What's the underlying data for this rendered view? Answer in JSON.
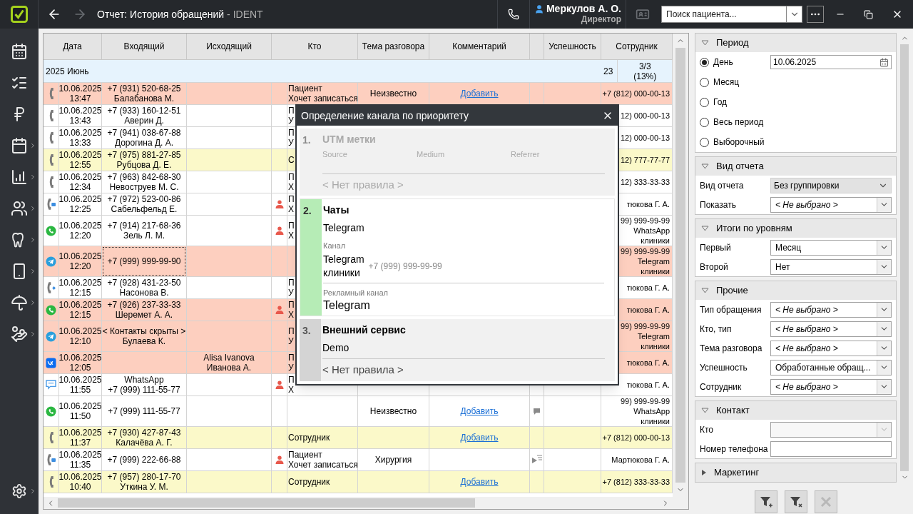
{
  "topbar": {
    "nav": [
      {
        "kind": "back",
        "disabled": false
      },
      {
        "kind": "forward",
        "disabled": true
      }
    ],
    "title": "Отчет: История обращений",
    "suffix": "- IDENT",
    "user": {
      "name": "Меркулов А. О.",
      "role": "Директор"
    },
    "card_disabled": true,
    "search": {
      "placeholder": "Поиск пациента..."
    }
  },
  "sidebar": {
    "items": [
      {
        "kind": "schedule",
        "submenu": false
      },
      {
        "kind": "tasks",
        "submenu": false
      },
      {
        "kind": "ruble",
        "submenu": false
      },
      {
        "kind": "calendar",
        "submenu": true
      },
      {
        "kind": "chart",
        "submenu": true
      },
      {
        "kind": "people",
        "submenu": true
      },
      {
        "kind": "tooth",
        "submenu": true
      },
      {
        "kind": "devices",
        "submenu": true
      },
      {
        "kind": "umbrella",
        "submenu": true
      },
      {
        "kind": "money",
        "submenu": true
      }
    ],
    "settings": {
      "submenu": true
    }
  },
  "table": {
    "columns": [
      "Дата",
      "Входящий",
      "Исходящий",
      "Кто",
      "Тема разговора",
      "Комментарий",
      "Успешность",
      "Сотрудник"
    ],
    "group": {
      "label": "2025 Июнь",
      "count": "23",
      "success": [
        "3/3",
        "(13%)"
      ]
    },
    "rows": [
      {
        "kind": "call",
        "color": "#fdcfbf",
        "date": [
          "10.06.2025",
          "13:47"
        ],
        "incoming": [
          "+7 (931) 520-68-25",
          "Балабанова М."
        ],
        "outgoing": [],
        "patient": false,
        "who": [
          "Пациент",
          "Хочет записаться"
        ],
        "topic": "Неизвестно",
        "comment": "Добавить",
        "employee": [
          "+7 (812) 000-00-13"
        ],
        "focused": false
      },
      {
        "kind": "call",
        "color": "#ffffff",
        "date": [
          "10.06.2025",
          "13:43"
        ],
        "incoming": [
          "+7 (933) 160-12-51",
          "Аверин Д."
        ],
        "outgoing": [],
        "patient": false,
        "who": [
          "П",
          "У"
        ],
        "employee": [
          "12) 000-00-13"
        ],
        "focused": false
      },
      {
        "kind": "call",
        "color": "#ffffff",
        "date": [
          "10.06.2025",
          "13:33"
        ],
        "incoming": [
          "+7 (941) 038-67-88",
          "Дорогина Д. А."
        ],
        "outgoing": [],
        "patient": false,
        "who": [
          "П",
          "У"
        ],
        "employee": [
          "12) 000-00-13"
        ],
        "focused": false
      },
      {
        "kind": "call",
        "color": "#fbf9c9",
        "date": [
          "10.06.2025",
          "12:55"
        ],
        "incoming": [
          "+7 (975) 881-27-85",
          "Рубцова Д. Е."
        ],
        "outgoing": [],
        "patient": false,
        "who": [
          "С"
        ],
        "employee": [
          "12) 777-77-77"
        ],
        "focused": false
      },
      {
        "kind": "call",
        "color": "#ffffff",
        "date": [
          "10.06.2025",
          "12:34"
        ],
        "incoming": [
          "+7 (963) 842-68-30",
          "Невоструев М. С."
        ],
        "outgoing": [],
        "patient": false,
        "who": [
          "П",
          "Х"
        ],
        "employee": [
          "12) 333-33-33"
        ],
        "focused": false
      },
      {
        "kind": "call-chat",
        "color": "#ffffff",
        "date": [
          "10.06.2025",
          "12:25"
        ],
        "incoming": [
          "+7 (972) 523-00-86",
          "Сабельфельд Е."
        ],
        "outgoing": [],
        "patient": true,
        "who": [
          "П",
          "Х"
        ],
        "employee": [
          "тюкова Г. А."
        ],
        "focused": false
      },
      {
        "kind": "whatsapp",
        "color": "#ffffff",
        "date": [
          "10.06.2025",
          "12:20"
        ],
        "incoming": [
          "+7 (914) 217-68-36",
          "Зель Л. М."
        ],
        "outgoing": [],
        "patient": true,
        "who": [
          "П",
          "Х"
        ],
        "employee": [
          "99) 999-99-99",
          "WhatsApp",
          "клиники"
        ],
        "focused": false
      },
      {
        "kind": "telegram",
        "color": "#fdcfbf",
        "date": [
          "10.06.2025",
          "12:20"
        ],
        "incoming": [
          "+7 (999) 999-99-90"
        ],
        "outgoing": [],
        "patient": false,
        "who": [],
        "employee": [
          "99) 999-99-99",
          "Telegram",
          "клиники"
        ],
        "focused": true
      },
      {
        "kind": "call-forward",
        "color": "#ffffff",
        "date": [
          "10.06.2025",
          "12:15"
        ],
        "incoming": [
          "+7 (928) 431-23-50",
          "Насонова В."
        ],
        "outgoing": [],
        "patient": false,
        "who": [
          "П",
          "У"
        ],
        "employee": [
          "тюкова Г. А."
        ],
        "focused": false
      },
      {
        "kind": "whatsapp",
        "color": "#fdcfbf",
        "date": [
          "10.06.2025",
          "12:15"
        ],
        "incoming": [
          "+7 (926) 237-33-33",
          "Шеремет А. А."
        ],
        "outgoing": [],
        "patient": true,
        "who": [
          "П",
          "Х"
        ],
        "employee": [
          "тюкова Г. А."
        ],
        "focused": false
      },
      {
        "kind": "telegram",
        "color": "#fdcfbf",
        "date": [
          "10.06.2025",
          "12:10"
        ],
        "incoming": [
          "< Контакты скрыты >",
          "Булаева К."
        ],
        "outgoing": [],
        "patient": false,
        "who": [
          "П",
          "У"
        ],
        "employee": [
          "99) 999-99-99",
          "Telegram",
          "клиники"
        ],
        "focused": false
      },
      {
        "kind": "vk",
        "color": "#fdcfbf",
        "date": [
          "10.06.2025",
          "12:05"
        ],
        "incoming": [],
        "outgoing": [
          "Alisa Ivanova",
          "Иванова А."
        ],
        "patient": false,
        "who": [
          "П",
          "У"
        ],
        "employee": [
          "тюкова Г. А."
        ],
        "focused": false
      },
      {
        "kind": "chat",
        "color": "#ffffff",
        "date": [
          "10.06.2025",
          "11:55"
        ],
        "incoming": [
          "WhatsApp",
          "+7 (999) 111-55-77"
        ],
        "outgoing": [],
        "patient": true,
        "who": [
          "П",
          "Х"
        ],
        "employee": [
          "тюкова Г. А."
        ],
        "focused": false
      },
      {
        "kind": "whatsapp",
        "color": "#ffffff",
        "date": [
          "10.06.2025",
          "11:50"
        ],
        "incoming": [
          "+7 (999) 111-55-77"
        ],
        "outgoing": [],
        "patient": false,
        "who": [],
        "topic": "Неизвестно",
        "comment": "Добавить",
        "note": {
          "kind": "chat"
        },
        "employee": [
          "99) 999-99-99",
          "WhatsApp",
          "клиники"
        ],
        "focused": false
      },
      {
        "kind": "call",
        "color": "#fbf9c9",
        "date": [
          "10.06.2025",
          "11:37"
        ],
        "incoming": [
          "+7 (930) 427-87-43",
          "Калачёва А. Г."
        ],
        "outgoing": [],
        "patient": false,
        "who": [
          "Сотрудник"
        ],
        "comment": "Добавить",
        "employee": [
          "+7 (812) 000-00-13"
        ],
        "focused": false
      },
      {
        "kind": "call-chat",
        "color": "#ffffff",
        "date": [
          "10.06.2025",
          "11:35"
        ],
        "incoming": [
          "+7 (999) 222-66-88"
        ],
        "outgoing": [],
        "patient": true,
        "who": [
          "Пациент",
          "Хочет записаться"
        ],
        "topic": "Хирургия",
        "note": {
          "kind": "list"
        },
        "employee": [
          "Мартюкова Г. А."
        ],
        "focused": false
      },
      {
        "kind": "call",
        "color": "#fbf9c9",
        "date": [
          "10.06.2025",
          "10:40"
        ],
        "incoming": [
          "+7 (957) 280-17-70",
          "Уткина У. М."
        ],
        "outgoing": [],
        "patient": false,
        "who": [
          "Сотрудник"
        ],
        "comment": "Добавить",
        "employee": [
          "+7 (812) 333-33-33"
        ],
        "focused": false
      }
    ]
  },
  "dialog": {
    "title": "Определение канала по приоритету",
    "sections": [
      {
        "number": "1.",
        "title": "UTM метки",
        "disabled": true,
        "matched": false,
        "params": [
          "Source",
          "Medium",
          "Referrer"
        ],
        "rule": "< Нет правила >"
      },
      {
        "number": "2.",
        "title": "Чаты",
        "disabled": false,
        "matched": true,
        "value": "Telegram",
        "channel": {
          "label": "Канал",
          "value": [
            "Telegram",
            "клиники"
          ],
          "phone": "+7 (999) 999-99-99"
        },
        "ad_channel": {
          "label": "Рекламный канал",
          "value": "Telegram"
        }
      },
      {
        "number": "3.",
        "title": "Внешний сервис",
        "disabled": false,
        "matched": false,
        "value": "Demo",
        "rule": "< Нет правила >"
      }
    ]
  },
  "filters": {
    "sections": [
      {
        "title": "Период",
        "expanded": true,
        "kind": "period",
        "date": "10.06.2025",
        "options": [
          {
            "label": "День",
            "selected": true
          },
          {
            "label": "Месяц",
            "selected": false
          },
          {
            "label": "Год",
            "selected": false
          },
          {
            "label": "Весь период",
            "selected": false
          },
          {
            "label": "Выборочный",
            "selected": false
          }
        ]
      },
      {
        "title": "Вид отчета",
        "expanded": true,
        "kind": "fields",
        "fields": [
          {
            "label": "Вид отчета",
            "kind": "flat",
            "value": "Без группировки",
            "disabled": false
          },
          {
            "label": "Показать",
            "kind": "select",
            "placeholder": "< Не выбрано >",
            "disabled": false
          }
        ]
      },
      {
        "title": "Итоги по уровням",
        "expanded": true,
        "kind": "fields",
        "fields": [
          {
            "label": "Первый",
            "kind": "select",
            "value": "Месяц",
            "disabled": false
          },
          {
            "label": "Второй",
            "kind": "select",
            "value": "Нет",
            "disabled": false
          }
        ]
      },
      {
        "title": "Прочие",
        "expanded": true,
        "kind": "fields",
        "fields": [
          {
            "label": "Тип обращения",
            "kind": "select",
            "placeholder": "< Не выбрано >",
            "disabled": false
          },
          {
            "label": "Кто, тип",
            "kind": "select",
            "placeholder": "< Не выбрано >",
            "disabled": false
          },
          {
            "label": "Тема разговора",
            "kind": "select",
            "placeholder": "< Не выбрано >",
            "disabled": false
          },
          {
            "label": "Успешность",
            "kind": "select",
            "value": "Обработанные обращ...",
            "disabled": false
          },
          {
            "label": "Сотрудник",
            "kind": "select",
            "placeholder": "< Не выбрано >",
            "disabled": false
          }
        ]
      },
      {
        "title": "Контакт",
        "expanded": true,
        "kind": "fields",
        "fields": [
          {
            "label": "Кто",
            "kind": "select",
            "disabled": true
          },
          {
            "label": "Номер телефона",
            "kind": "input",
            "disabled": false
          }
        ]
      },
      {
        "title": "Маркетинг",
        "expanded": false
      }
    ],
    "buttons": [
      {
        "kind": "add-filter",
        "disabled": false
      },
      {
        "kind": "clear-filter",
        "disabled": false
      },
      {
        "kind": "close",
        "disabled": true
      }
    ]
  }
}
